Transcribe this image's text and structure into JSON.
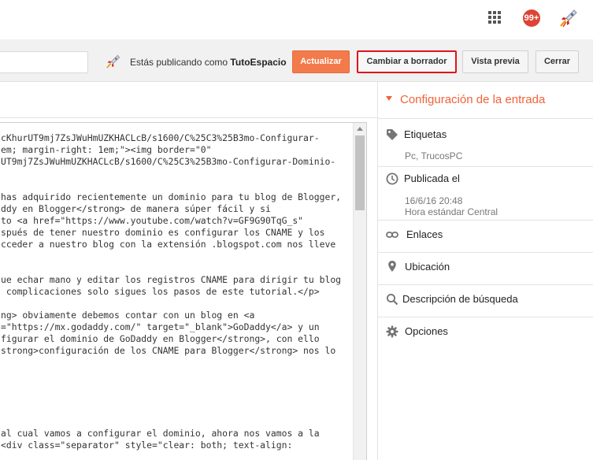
{
  "topbar": {
    "notification_count": "99+"
  },
  "header": {
    "publishing_prefix": "Estás publicando como",
    "publishing_user": "TutoEspacio",
    "buttons": {
      "publish": "Actualizar",
      "draft": "Cambiar a borrador",
      "preview": "Vista previa",
      "close": "Cerrar"
    }
  },
  "editor": {
    "lines": [
      "cKhurUT9mj7ZsJWuHmUZKHACLcB/s1600/C%25C3%25B3mo-Configurar-",
      "em; margin-right: 1em;\"><img border=\"0\"",
      "UT9mj7ZsJWuHmUZKHACLcB/s1600/C%25C3%25B3mo-Configurar-Dominio-",
      "",
      "",
      "has adquirido recientemente un dominio para tu blog de Blogger,",
      "ddy en Blogger</strong> de manera súper fácil y si",
      "to <a href=\"https://www.youtube.com/watch?v=GF9G90TqG_s\"",
      "spués de tener nuestro dominio es configurar los CNAME y los",
      "cceder a nuestro blog con la extensión .blogspot.com nos lleve",
      "",
      "",
      "ue echar mano y editar los registros CNAME para dirigir tu blog",
      " complicaciones solo sigues los pasos de este tutorial.</p>",
      "",
      "ng> obviamente debemos contar con un blog en <a",
      "=\"https://mx.godaddy.com/\" target=\"_blank\">GoDaddy</a> y un",
      "figurar el dominio de GoDaddy en Blogger</strong>, con ello",
      "strong>configuración de los CNAME para Blogger</strong> nos lo",
      "",
      "",
      "",
      "",
      "",
      "",
      "al cual vamos a configurar el dominio, ahora nos vamos a la",
      "<div class=\"separator\" style=\"clear: both; text-align:"
    ]
  },
  "settings": {
    "title": "Configuración de la entrada",
    "labels": {
      "label": "Etiquetas",
      "labels_value": "Pc, TrucosPC",
      "published": "Publicada el",
      "published_date": "16/6/16 20:48",
      "published_tz": "Hora estándar Central",
      "links": "Enlaces",
      "location": "Ubicación",
      "search_desc": "Descripción de búsqueda",
      "options": "Opciones"
    }
  },
  "colors": {
    "accent": "#f1623a",
    "publish_button": "#f37a4b",
    "draft_highlight": "#e0131c"
  }
}
